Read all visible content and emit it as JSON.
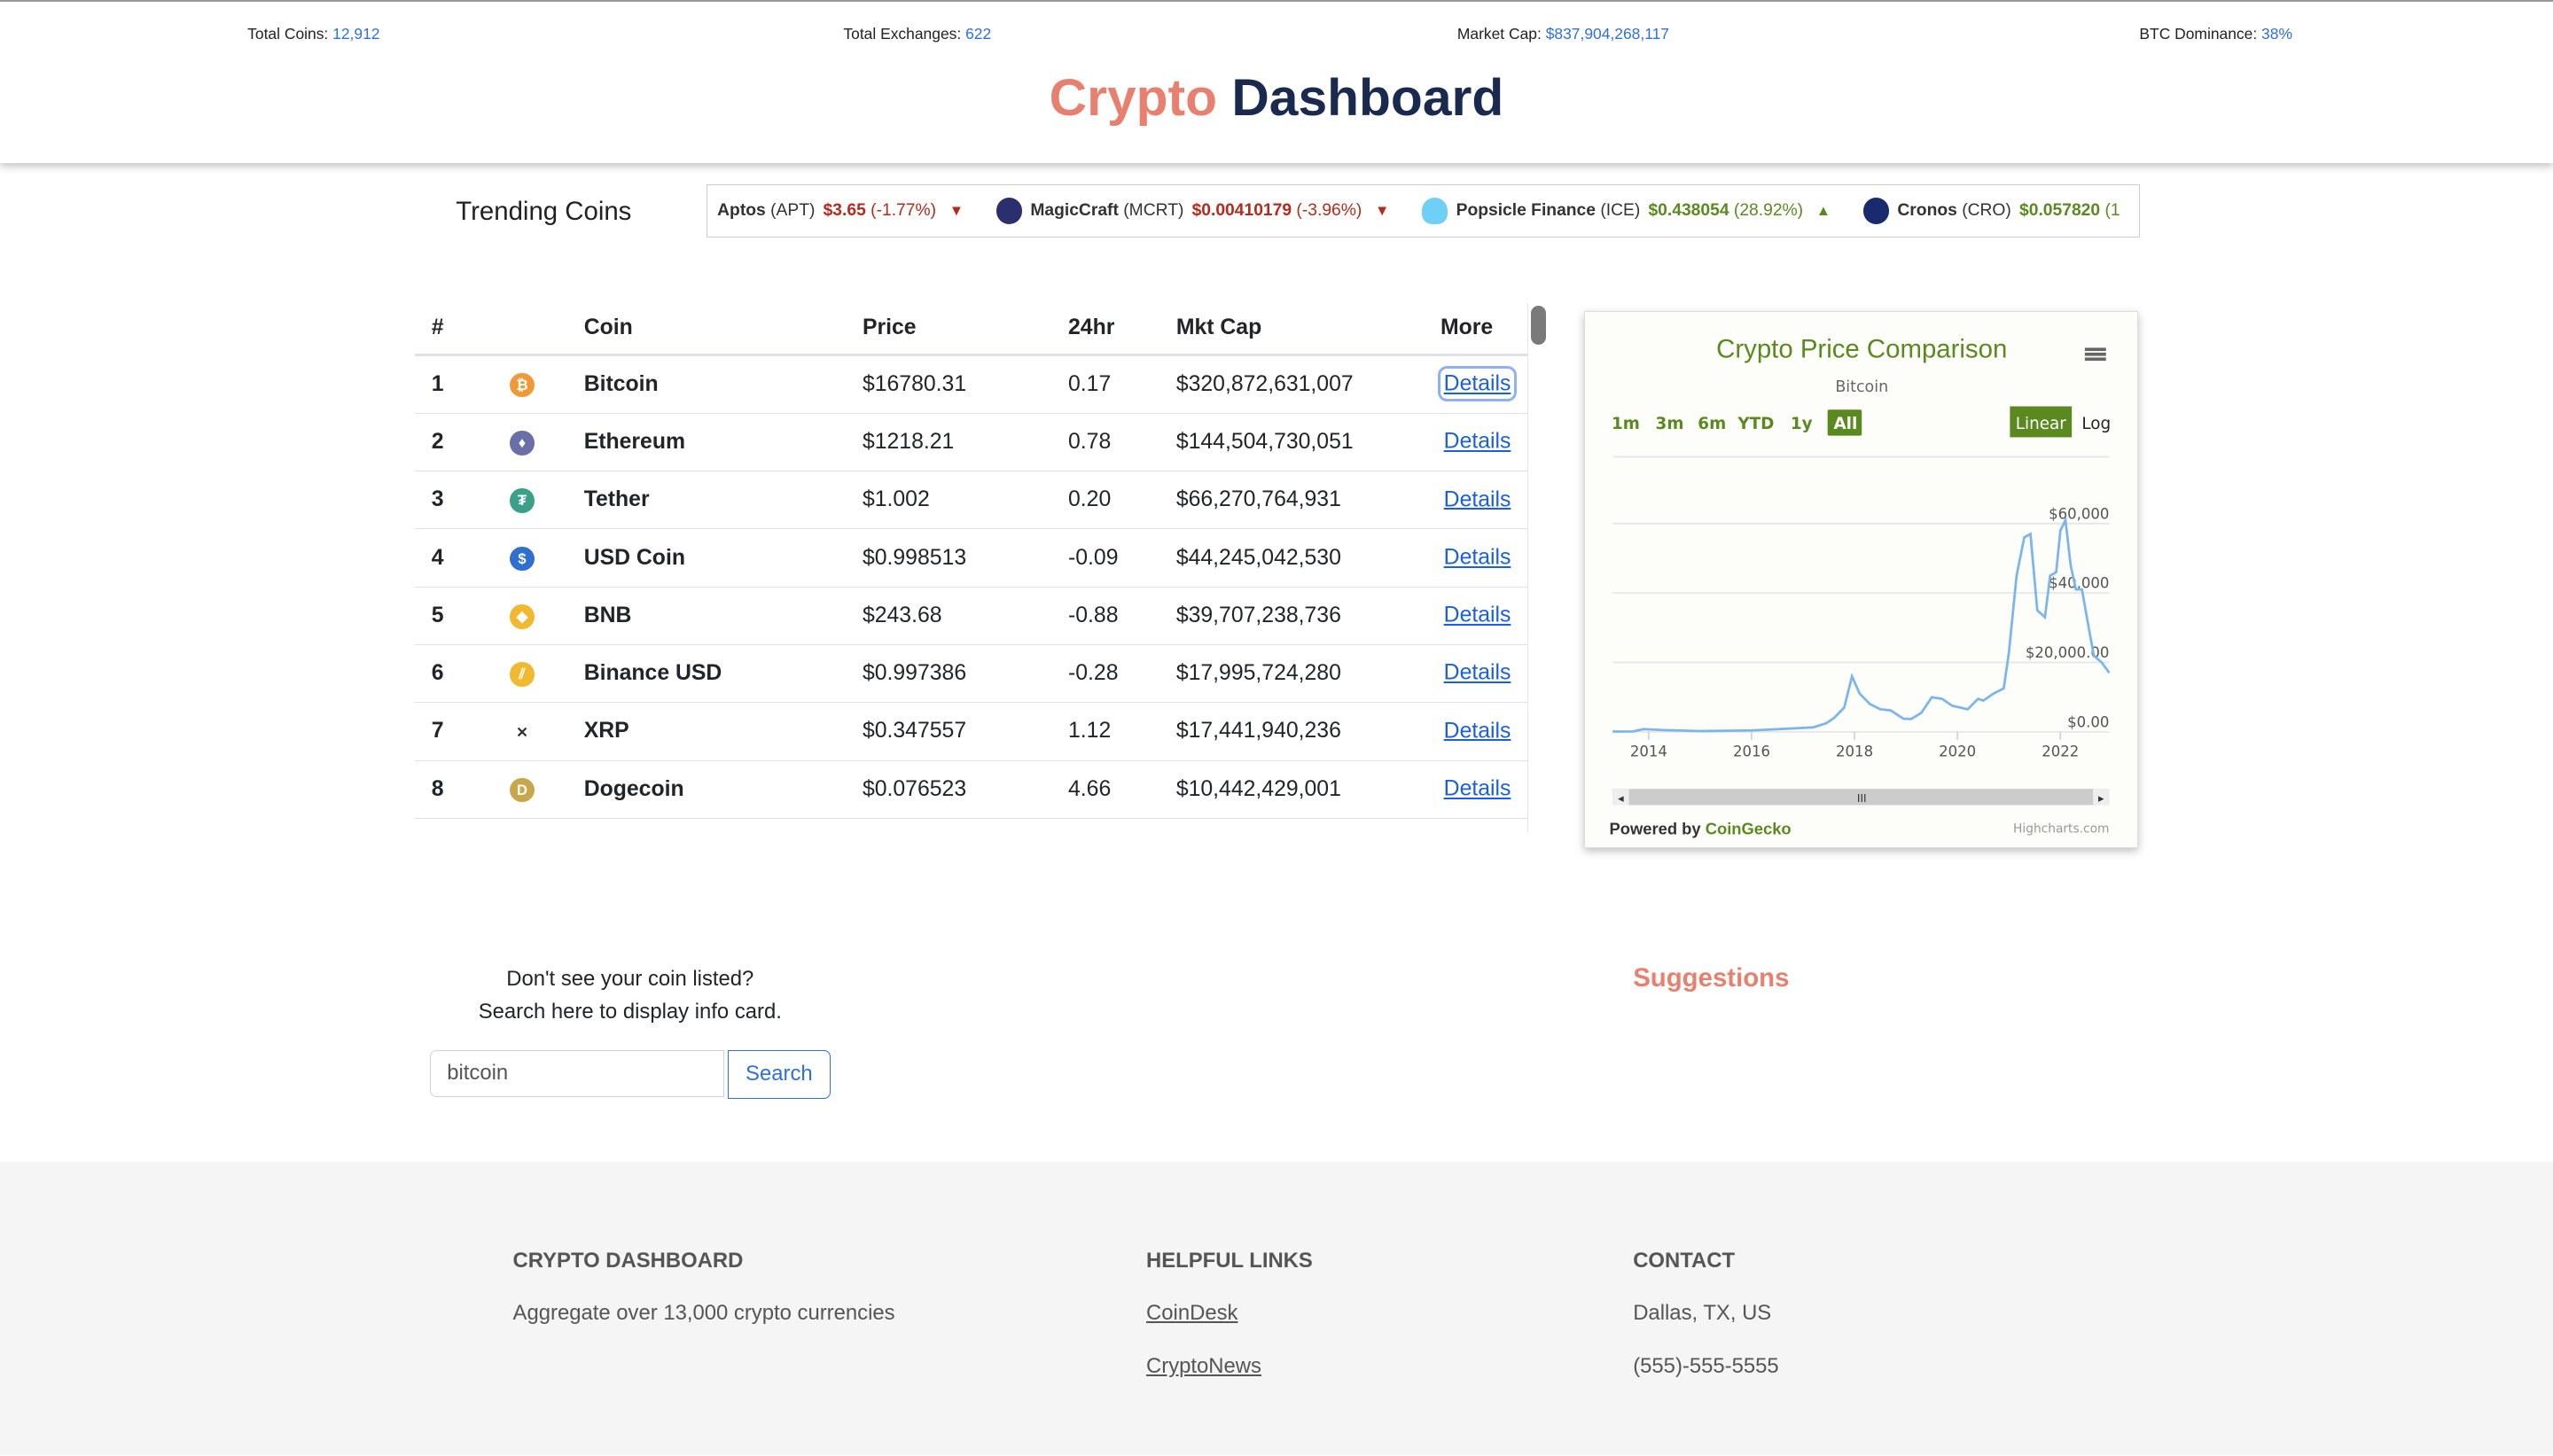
{
  "stats": [
    {
      "label": "Total Coins:",
      "value": "12,912"
    },
    {
      "label": "Total Exchanges:",
      "value": "622"
    },
    {
      "label": "Market Cap:",
      "value": "$837,904,268,117"
    },
    {
      "label": "BTC Dominance:",
      "value": "38%"
    }
  ],
  "title": {
    "part1": "Crypto",
    "part2": "Dashboard"
  },
  "trending": {
    "label": "Trending Coins",
    "items": [
      {
        "name": "Aptos",
        "symbol": "(APT)",
        "price": "$3.65",
        "change": "(-1.77%)",
        "dir": "down"
      },
      {
        "name": "MagicCraft",
        "symbol": "(MCRT)",
        "price": "$0.00410179",
        "change": "(-3.96%)",
        "dir": "down"
      },
      {
        "name": "Popsicle Finance",
        "symbol": "(ICE)",
        "price": "$0.438054",
        "change": "(28.92%)",
        "dir": "up"
      },
      {
        "name": "Cronos",
        "symbol": "(CRO)",
        "price": "$0.057820",
        "change": "(1",
        "dir": "up"
      }
    ]
  },
  "table": {
    "headers": [
      "#",
      "",
      "Coin",
      "Price",
      "24hr",
      "Mkt Cap",
      "More"
    ],
    "link_label": "Details",
    "rows": [
      {
        "rank": "1",
        "coin": "Bitcoin",
        "price": "$16780.31",
        "change": "0.17",
        "cap": "$320,872,631,007",
        "color": "#f09a37",
        "glyph": "₿"
      },
      {
        "rank": "2",
        "coin": "Ethereum",
        "price": "$1218.21",
        "change": "0.78",
        "cap": "$144,504,730,051",
        "color": "#6b6fa8",
        "glyph": "♦"
      },
      {
        "rank": "3",
        "coin": "Tether",
        "price": "$1.002",
        "change": "0.20",
        "cap": "$66,270,764,931",
        "color": "#3aa08a",
        "glyph": "₮"
      },
      {
        "rank": "4",
        "coin": "USD Coin",
        "price": "$0.998513",
        "change": "-0.09",
        "cap": "$44,245,042,530",
        "color": "#2f6fd0",
        "glyph": "$"
      },
      {
        "rank": "5",
        "coin": "BNB",
        "price": "$243.68",
        "change": "-0.88",
        "cap": "$39,707,238,736",
        "color": "#f0b92f",
        "glyph": "◆"
      },
      {
        "rank": "6",
        "coin": "Binance USD",
        "price": "$0.997386",
        "change": "-0.28",
        "cap": "$17,995,724,280",
        "color": "#f0b92f",
        "glyph": "⫽"
      },
      {
        "rank": "7",
        "coin": "XRP",
        "price": "$0.347557",
        "change": "1.12",
        "cap": "$17,441,940,236",
        "color": "#ffffff",
        "glyph": "✕"
      },
      {
        "rank": "8",
        "coin": "Dogecoin",
        "price": "$0.076523",
        "change": "4.66",
        "cap": "$10,442,429,001",
        "color": "#c8a74a",
        "glyph": "D"
      }
    ]
  },
  "chart_data": {
    "type": "line",
    "title": "Crypto Price Comparison",
    "subtitle": "Bitcoin",
    "ylabel": "",
    "xlabel": "",
    "range_buttons": [
      "1m",
      "3m",
      "6m",
      "YTD",
      "1y",
      "All"
    ],
    "selected_range": "All",
    "scale_buttons": [
      "Linear",
      "Log"
    ],
    "selected_scale": "Linear",
    "x_ticks": [
      "2014",
      "2016",
      "2018",
      "2020",
      "2022"
    ],
    "y_ticks": [
      "$0.00",
      "$20,000.00",
      "$40,000",
      "$60,000"
    ],
    "xlim": [
      2013.3,
      2022.95
    ],
    "ylim": [
      0,
      60000
    ],
    "series": [
      {
        "name": "Bitcoin",
        "x": [
          2013.3,
          2013.7,
          2013.9,
          2014.3,
          2015,
          2016,
          2016.8,
          2017.2,
          2017.45,
          2017.6,
          2017.8,
          2017.95,
          2018.1,
          2018.3,
          2018.5,
          2018.7,
          2018.95,
          2019.1,
          2019.3,
          2019.5,
          2019.7,
          2019.9,
          2020.2,
          2020.4,
          2020.5,
          2020.7,
          2020.9,
          2021.0,
          2021.15,
          2021.3,
          2021.42,
          2021.55,
          2021.7,
          2021.8,
          2021.92,
          2022.0,
          2022.1,
          2022.2,
          2022.3,
          2022.42,
          2022.55,
          2022.65,
          2022.8,
          2022.95
        ],
        "y": [
          100,
          150,
          800,
          500,
          250,
          400,
          1000,
          1300,
          2500,
          4000,
          7000,
          16000,
          11000,
          8000,
          6500,
          6200,
          3800,
          3700,
          5500,
          10000,
          9500,
          7500,
          6500,
          9500,
          9000,
          11000,
          12500,
          23000,
          45000,
          56000,
          57000,
          35000,
          33000,
          45000,
          46000,
          58000,
          61000,
          48000,
          41000,
          41000,
          30000,
          22000,
          20000,
          17000
        ]
      }
    ],
    "credits": {
      "powered": "Powered by",
      "brand": "CoinGecko",
      "highcharts": "Highcharts.com"
    }
  },
  "search": {
    "prompt1": "Don't see your coin listed?",
    "prompt2": "Search here to display info card.",
    "value": "bitcoin",
    "button": "Search"
  },
  "suggestions": {
    "title": "Suggestions"
  },
  "footer": {
    "col1": {
      "heading": "CRYPTO DASHBOARD",
      "text": "Aggregate over 13,000 crypto currencies"
    },
    "col2": {
      "heading": "HELPFUL LINKS",
      "links": [
        "CoinDesk",
        "CryptoNews"
      ]
    },
    "col3": {
      "heading": "CONTACT",
      "location": "Dallas, TX, US",
      "phone": "(555)-555-5555"
    }
  },
  "colors": {
    "accent": "#e8806f",
    "navy": "#1a2a4f",
    "green": "#5a8a1f",
    "link": "#2f6fdf",
    "line": "#7cb5ec"
  }
}
